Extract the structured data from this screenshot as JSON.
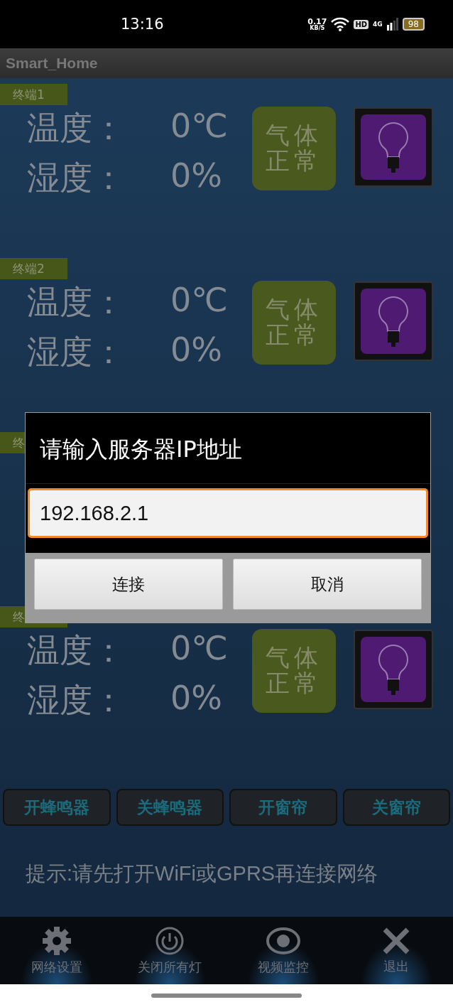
{
  "status_bar": {
    "time": "13:16",
    "net_speed": "0.17",
    "net_unit": "KB/S",
    "hd": "HD",
    "network": "4G",
    "battery": "98"
  },
  "app_bar": {
    "title": "Smart_Home"
  },
  "terminals": [
    {
      "label": "终端1",
      "temperature_label": "温度：",
      "temperature": "0℃",
      "humidity_label": "湿度：",
      "humidity": "0%",
      "gas_lines": [
        "气体",
        "正常"
      ]
    },
    {
      "label": "终端2",
      "temperature_label": "温度：",
      "temperature": "0℃",
      "humidity_label": "湿度：",
      "humidity": "0%",
      "gas_lines": [
        "气体",
        "正常"
      ]
    },
    {
      "label": "终"
    },
    {
      "label": "终",
      "temperature_label": "温度：",
      "temperature": "0℃",
      "humidity_label": "湿度：",
      "humidity": "0%",
      "gas_lines": [
        "气体",
        "正常"
      ]
    }
  ],
  "control_buttons": [
    "开蜂鸣器",
    "关蜂鸣器",
    "开窗帘",
    "关窗帘"
  ],
  "hint": "提示:请先打开WiFi或GPRS再连接网络",
  "nav": [
    {
      "kind": "gear",
      "label": "网络设置"
    },
    {
      "kind": "power",
      "label": "关闭所有灯"
    },
    {
      "kind": "eye",
      "label": "视频监控"
    },
    {
      "kind": "close",
      "label": "退出"
    }
  ],
  "dialog": {
    "title": "请输入服务器IP地址",
    "value": "192.168.2.1",
    "buttons": [
      "连接",
      "取消"
    ]
  }
}
